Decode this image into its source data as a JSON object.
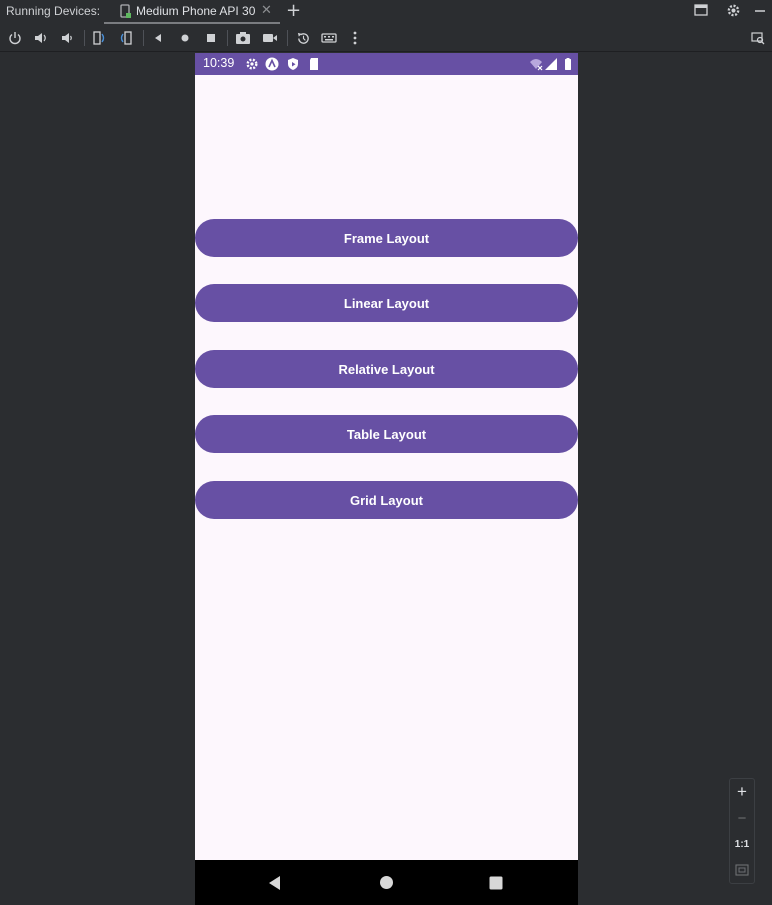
{
  "tabbar": {
    "running_label": "Running Devices:",
    "device_tab": "Medium Phone API 30",
    "close_glyph": "✕",
    "add_glyph": "+"
  },
  "toolbar": {
    "icons": [
      "power-icon",
      "volume-up-icon",
      "volume-down-icon",
      "rotate-left-icon",
      "rotate-right-icon",
      "back-icon",
      "home-icon",
      "overview-icon",
      "screenshot-icon",
      "screen-record-icon",
      "reset-icon",
      "keyboard-icon",
      "more-icon"
    ]
  },
  "phone": {
    "status_time": "10:39",
    "buttons": [
      {
        "label": "Frame Layout"
      },
      {
        "label": "Linear Layout"
      },
      {
        "label": "Relative Layout"
      },
      {
        "label": "Table Layout"
      },
      {
        "label": "Grid Layout"
      }
    ]
  },
  "zoom": {
    "plus": "+",
    "minus": "−",
    "one_to_one": "1:1"
  },
  "colors": {
    "accent": "#6750a4",
    "screen_bg": "#fdf7fd",
    "ide_bg": "#2b2d30"
  }
}
